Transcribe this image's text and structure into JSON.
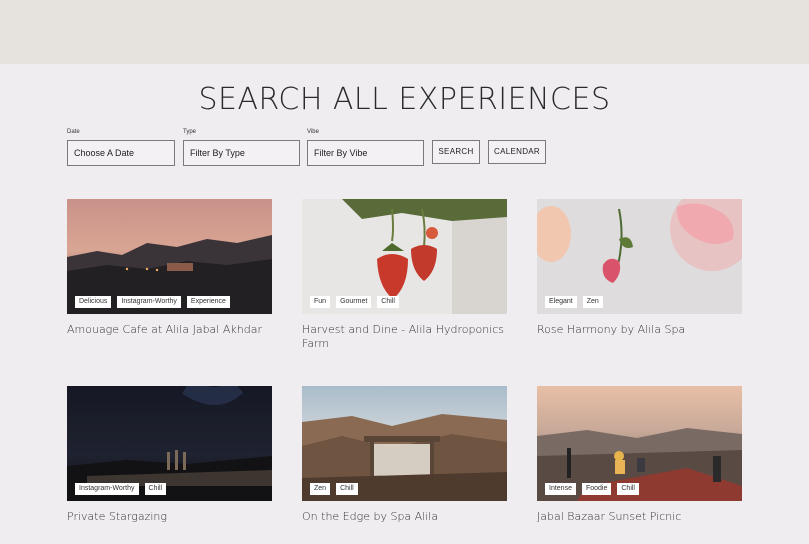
{
  "page_title": "SEARCH ALL EXPERIENCES",
  "filters": {
    "date": {
      "label": "Date",
      "value": "Choose A Date"
    },
    "type": {
      "label": "Type",
      "value": "Filter By Type"
    },
    "vibe": {
      "label": "Vibe",
      "value": "Filter By Vibe"
    },
    "search_label": "SEARCH",
    "calendar_label": "CALENDAR"
  },
  "cards": [
    {
      "title": "Amouage Cafe at Alila Jabal Akhdar",
      "tags": [
        "Delicious",
        "Instagram-Worthy",
        "Experience"
      ]
    },
    {
      "title": "Harvest and Dine - Alila Hydroponics Farm",
      "tags": [
        "Fun",
        "Gourmet",
        "Chill"
      ]
    },
    {
      "title": "Rose Harmony by Alila Spa",
      "tags": [
        "Elegant",
        "Zen"
      ]
    },
    {
      "title": "Private Stargazing",
      "tags": [
        "Instagram-Worthy",
        "Chill"
      ]
    },
    {
      "title": "On the Edge by Spa Alila",
      "tags": [
        "Zen",
        "Chill"
      ]
    },
    {
      "title": "Jabal Bazaar Sunset Picnic",
      "tags": [
        "Intense",
        "Foodie",
        "Chill"
      ]
    }
  ]
}
